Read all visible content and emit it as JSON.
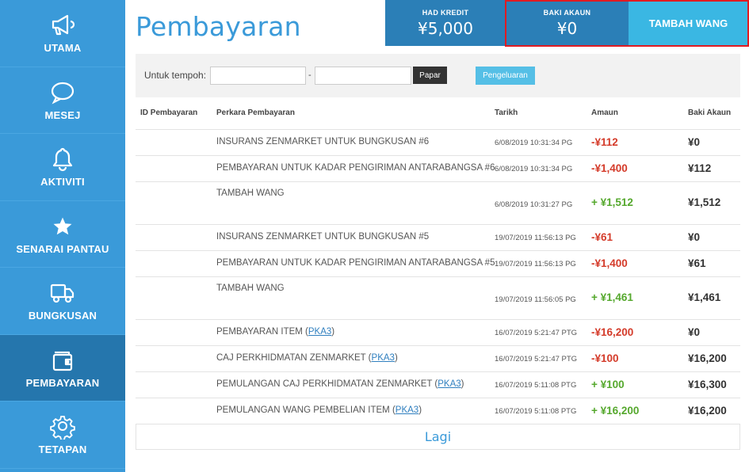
{
  "sidebar": {
    "items": [
      {
        "label": "UTAMA",
        "icon": "megaphone-icon"
      },
      {
        "label": "MESEJ",
        "icon": "chat-bubble-icon"
      },
      {
        "label": "AKTIVITI",
        "icon": "bell-icon"
      },
      {
        "label": "SENARAI PANTAU",
        "icon": "star-icon"
      },
      {
        "label": "BUNGKUSAN",
        "icon": "truck-icon"
      },
      {
        "label": "PEMBAYARAN",
        "icon": "wallet-icon",
        "active": true
      },
      {
        "label": "TETAPAN",
        "icon": "gear-icon"
      }
    ]
  },
  "header": {
    "title": "Pembayaran",
    "credit_label": "HAD KREDIT",
    "credit_value": "¥5,000",
    "balance_label": "BAKI AKAUN",
    "balance_value": "¥0",
    "add_label": "TAMBAH WANG"
  },
  "filter": {
    "label": "Untuk tempoh:",
    "from_value": "",
    "separator": "-",
    "to_value": "",
    "show_label": "Papar",
    "expense_label": "Pengeluaran"
  },
  "table": {
    "headers": {
      "id": "ID Pembayaran",
      "desc": "Perkara Pembayaran",
      "date": "Tarikh",
      "amount": "Amaun",
      "balance": "Baki Akaun"
    },
    "rows": [
      {
        "desc": "INSURANS ZENMARKET UNTUK BUNGKUSAN #6",
        "link": "",
        "suffix": "",
        "date": "6/08/2019 10:31:34 PG",
        "amount": "-¥112",
        "sign": "neg",
        "balance": "¥0",
        "tall": false
      },
      {
        "desc": "PEMBAYARAN UNTUK KADAR PENGIRIMAN ANTARABANGSA #6",
        "link": "",
        "suffix": "",
        "date": "6/08/2019 10:31:34 PG",
        "amount": "-¥1,400",
        "sign": "neg",
        "balance": "¥112",
        "tall": false
      },
      {
        "desc": "TAMBAH WANG",
        "link": "",
        "suffix": "",
        "date": "6/08/2019 10:31:27 PG",
        "amount": "+ ¥1,512",
        "sign": "pos",
        "balance": "¥1,512",
        "tall": true
      },
      {
        "desc": "INSURANS ZENMARKET UNTUK BUNGKUSAN #5",
        "link": "",
        "suffix": "",
        "date": "19/07/2019 11:56:13 PG",
        "amount": "-¥61",
        "sign": "neg",
        "balance": "¥0",
        "tall": false
      },
      {
        "desc": "PEMBAYARAN UNTUK KADAR PENGIRIMAN ANTARABANGSA #5",
        "link": "",
        "suffix": "",
        "date": "19/07/2019 11:56:13 PG",
        "amount": "-¥1,400",
        "sign": "neg",
        "balance": "¥61",
        "tall": false
      },
      {
        "desc": "TAMBAH WANG",
        "link": "",
        "suffix": "",
        "date": "19/07/2019 11:56:05 PG",
        "amount": "+ ¥1,461",
        "sign": "pos",
        "balance": "¥1,461",
        "tall": true
      },
      {
        "desc": "PEMBAYARAN ITEM (",
        "link": "PKA3",
        "suffix": ")",
        "date": "16/07/2019 5:21:47 PTG",
        "amount": "-¥16,200",
        "sign": "neg",
        "balance": "¥0",
        "tall": false
      },
      {
        "desc": "CAJ PERKHIDMATAN ZENMARKET (",
        "link": "PKA3",
        "suffix": ")",
        "date": "16/07/2019 5:21:47 PTG",
        "amount": "-¥100",
        "sign": "neg",
        "balance": "¥16,200",
        "tall": false
      },
      {
        "desc": "PEMULANGAN CAJ PERKHIDMATAN ZENMARKET (",
        "link": "PKA3",
        "suffix": ")",
        "date": "16/07/2019 5:11:08 PTG",
        "amount": "+ ¥100",
        "sign": "pos",
        "balance": "¥16,300",
        "tall": false
      },
      {
        "desc": "PEMULANGAN WANG PEMBELIAN ITEM (",
        "link": "PKA3",
        "suffix": ")",
        "date": "16/07/2019 5:11:08 PTG",
        "amount": "+ ¥16,200",
        "sign": "pos",
        "balance": "¥16,200",
        "tall": false
      }
    ]
  },
  "more_label": "Lagi",
  "colors": {
    "sidebar": "#3a9ad9",
    "sidebar_active": "#2576ad",
    "header_dark": "#2b7fb7",
    "add_button": "#3ab7e3",
    "negative": "#d43b2a",
    "positive": "#55a82d",
    "highlight_border": "#e01b22"
  }
}
